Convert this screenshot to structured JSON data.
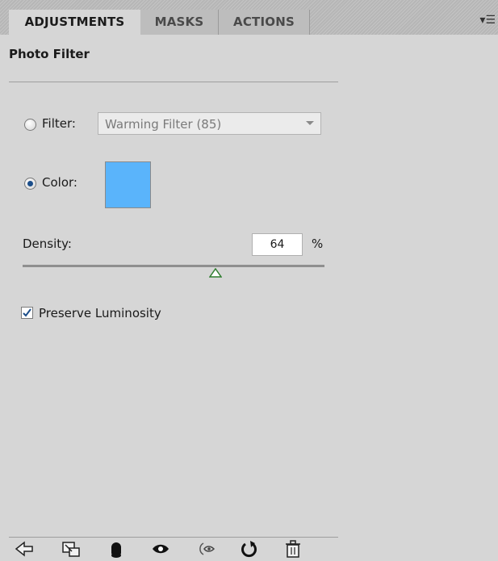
{
  "tabs": [
    {
      "label": "ADJUSTMENTS",
      "active": true
    },
    {
      "label": "MASKS",
      "active": false
    },
    {
      "label": "ACTIONS",
      "active": false
    }
  ],
  "panel_menu_icon": "panel-menu-icon",
  "panel": {
    "title": "Photo Filter",
    "filter": {
      "label": "Filter:",
      "value": "Warming Filter (85)",
      "selected": false
    },
    "color": {
      "label": "Color:",
      "selected": true,
      "swatch": "#5ab4fb"
    },
    "density": {
      "label": "Density:",
      "value": "64",
      "unit": "%",
      "percent": 64
    },
    "preserve_luminosity": {
      "label": "Preserve Luminosity",
      "checked": true
    }
  },
  "toolbar_icons": [
    "back-arrow-icon",
    "expanded-view-icon",
    "clip-to-layer-icon",
    "visibility-eye-icon",
    "view-previous-state-icon",
    "reset-icon",
    "delete-trash-icon"
  ],
  "colors": {
    "radio_dot": "#1c4e8a",
    "slider_thumb": "#2f7d2f"
  }
}
